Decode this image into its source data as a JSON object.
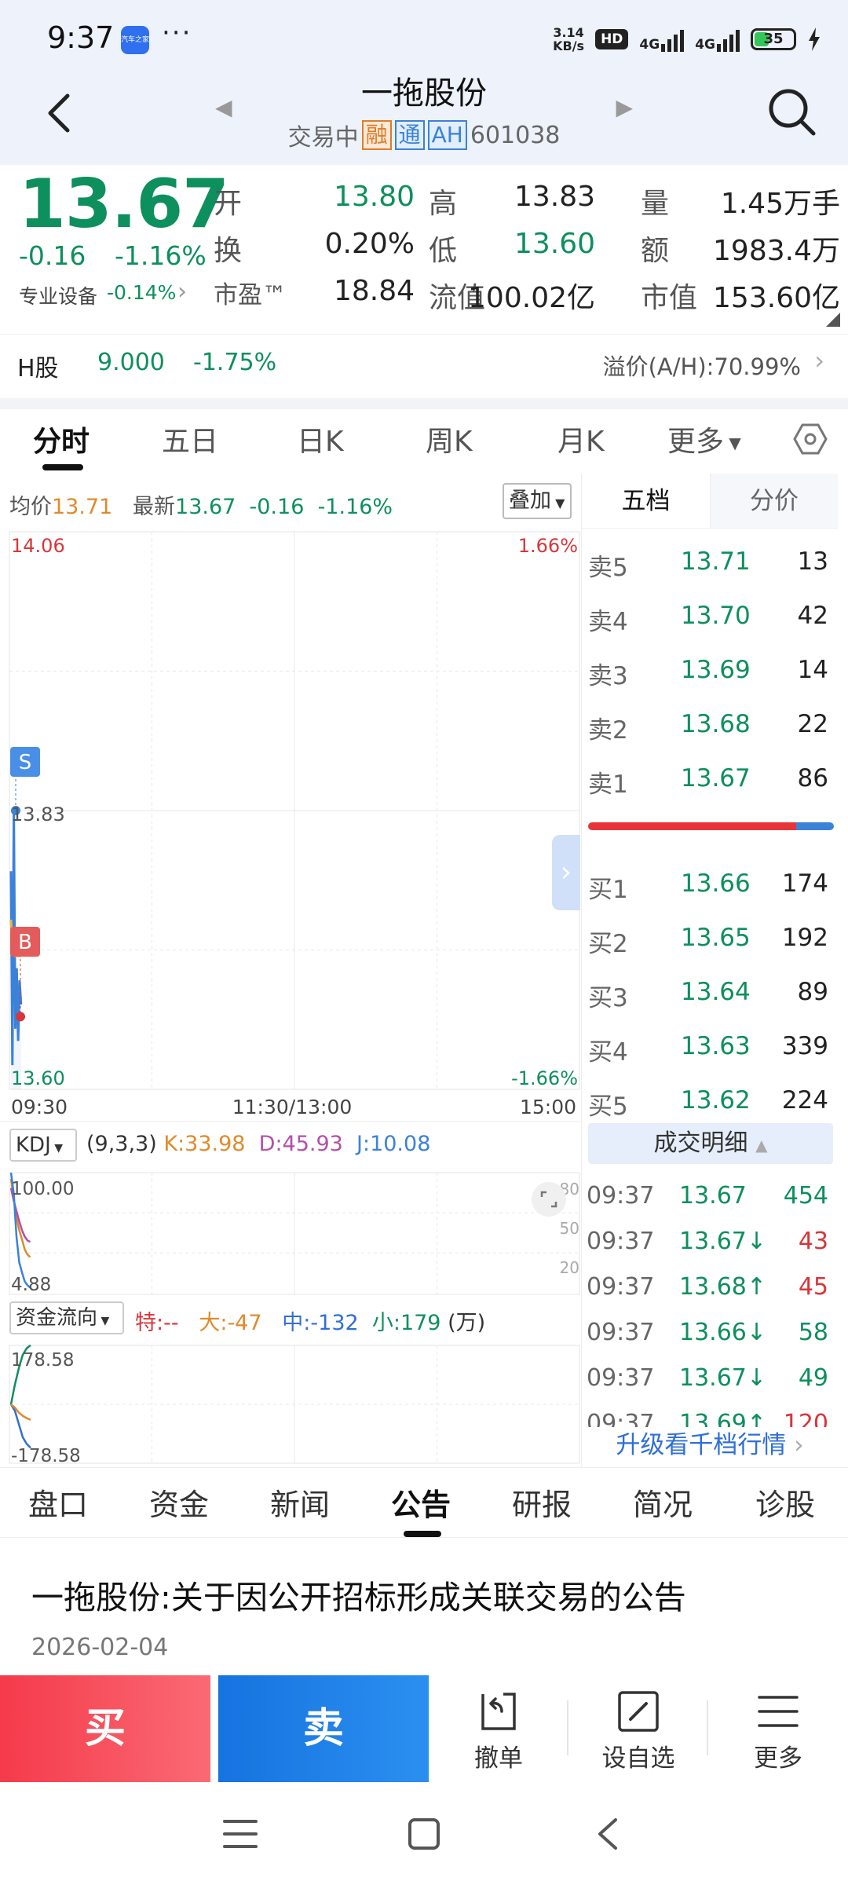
{
  "status": {
    "time": "9:37",
    "app_icon_text": "汽车之家",
    "dots": "···",
    "speed_value": "3.14",
    "speed_unit": "KB/s",
    "hd": "HD",
    "net1": "4G",
    "net2": "4G",
    "battery": "35"
  },
  "header": {
    "title": "一拖股份",
    "status": "交易中",
    "tag_rong": "融",
    "tag_tong": "通",
    "tag_ah": "AH",
    "code": "601038"
  },
  "quote": {
    "price": "13.67",
    "change": "-0.16",
    "change_pct": "-1.16%",
    "industry": "专业设备",
    "industry_chg": "-0.14%",
    "rows": [
      [
        {
          "l": "开",
          "v": "13.80",
          "c": "green"
        },
        {
          "l": "高",
          "v": "13.83",
          "c": "dark"
        },
        {
          "l": "量",
          "v": "1.45万手",
          "c": "dark"
        }
      ],
      [
        {
          "l": "换",
          "v": "0.20%",
          "c": "dark"
        },
        {
          "l": "低",
          "v": "13.60",
          "c": "green"
        },
        {
          "l": "额",
          "v": "1983.4万",
          "c": "dark"
        }
      ],
      [
        {
          "l": "市盈™",
          "v": "18.84",
          "c": "dark"
        },
        {
          "l": "流值",
          "v": "100.02亿",
          "c": "dark"
        },
        {
          "l": "市值",
          "v": "153.60亿",
          "c": "dark"
        }
      ]
    ]
  },
  "hshare": {
    "label": "H股",
    "price": "9.000",
    "change_pct": "-1.75%",
    "premium": "溢价(A/H):70.99%"
  },
  "chart_tabs": [
    "分时",
    "五日",
    "日K",
    "周K",
    "月K",
    "更多"
  ],
  "info": {
    "avg_label": "均价",
    "avg_value": "13.71",
    "latest_label": "最新",
    "latest_value": "13.67",
    "latest_chg": "-0.16",
    "latest_pct": "-1.16%",
    "overlay": "叠加"
  },
  "chart_data": [
    {
      "type": "line",
      "title": "",
      "y_top_label": "14.06",
      "y_mid_label": "13.83",
      "y_bottom_label": "13.60",
      "pct_top": "1.66%",
      "pct_bottom": "-1.66%",
      "ylim": [
        13.6,
        14.06
      ],
      "x_labels": [
        "09:30",
        "11:30/13:00",
        "15:00"
      ],
      "marker_s": "S",
      "marker_b": "B",
      "x": [
        0,
        1,
        2,
        3,
        4,
        5,
        6,
        7
      ],
      "series": [
        {
          "values": [
            13.78,
            13.62,
            13.83,
            13.65,
            13.7,
            13.64,
            13.69,
            13.67
          ]
        },
        {
          "values": [
            13.74,
            13.72,
            13.73,
            13.71,
            13.71,
            13.71,
            13.71,
            13.71
          ]
        }
      ],
      "total_points": 240
    },
    {
      "type": "line",
      "indicator": "KDJ",
      "params": "(9,3,3)",
      "k_label": "K:33.98",
      "d_label": "D:45.93",
      "j_label": "J:10.08",
      "y_top_label": "100.00",
      "y_bottom_label": "4.88",
      "right_ticks": [
        "80",
        "50",
        "20"
      ],
      "ylim": [
        4.88,
        100
      ],
      "x": [
        0,
        1,
        2,
        3,
        4,
        5,
        6,
        7
      ],
      "series": [
        {
          "values": [
            95,
            80,
            65,
            55,
            48,
            40,
            36,
            33.98
          ]
        },
        {
          "values": [
            88,
            78,
            70,
            62,
            55,
            50,
            47,
            45.93
          ]
        },
        {
          "values": [
            100,
            84,
            50,
            30,
            22,
            15,
            12,
            10.08
          ]
        }
      ]
    },
    {
      "type": "line",
      "indicator": "资金流向",
      "te": "特:--",
      "da": "大:-47",
      "zhong": "中:-132",
      "xiao": "小:179",
      "unit": "(万)",
      "y_top_label": "178.58",
      "y_bottom_label": "-178.58",
      "ylim": [
        -178.58,
        178.58
      ],
      "x": [
        0,
        1,
        2,
        3,
        4,
        5
      ],
      "series": [
        {
          "values": [
            0,
            60,
            110,
            150,
            170,
            179
          ]
        },
        {
          "values": [
            0,
            -20,
            -60,
            -100,
            -120,
            -132
          ]
        },
        {
          "values": [
            0,
            -10,
            -25,
            -35,
            -42,
            -47
          ]
        }
      ]
    }
  ],
  "orderbook": {
    "tab1": "五档",
    "tab2": "分价",
    "asks": [
      {
        "l": "卖5",
        "p": "13.71",
        "q": "13"
      },
      {
        "l": "卖4",
        "p": "13.70",
        "q": "42"
      },
      {
        "l": "卖3",
        "p": "13.69",
        "q": "14"
      },
      {
        "l": "卖2",
        "p": "13.68",
        "q": "22"
      },
      {
        "l": "卖1",
        "p": "13.67",
        "q": "86"
      }
    ],
    "bids": [
      {
        "l": "买1",
        "p": "13.66",
        "q": "174"
      },
      {
        "l": "买2",
        "p": "13.65",
        "q": "192"
      },
      {
        "l": "买3",
        "p": "13.64",
        "q": "89"
      },
      {
        "l": "买4",
        "p": "13.63",
        "q": "339"
      },
      {
        "l": "买5",
        "p": "13.62",
        "q": "224"
      }
    ],
    "detail_label": "成交明细",
    "trades": [
      {
        "t": "09:37",
        "p": "13.67",
        "pc": "green",
        "v": "454",
        "vc": "green"
      },
      {
        "t": "09:37",
        "p": "13.67↓",
        "pc": "green",
        "v": "43",
        "vc": "red"
      },
      {
        "t": "09:37",
        "p": "13.68↑",
        "pc": "green",
        "v": "45",
        "vc": "red"
      },
      {
        "t": "09:37",
        "p": "13.66↓",
        "pc": "green",
        "v": "58",
        "vc": "green"
      },
      {
        "t": "09:37",
        "p": "13.67↓",
        "pc": "green",
        "v": "49",
        "vc": "green"
      },
      {
        "t": "09:37",
        "p": "13.69↑",
        "pc": "green",
        "v": "120",
        "vc": "red"
      }
    ],
    "upgrade": "升级看千档行情"
  },
  "bottom_tabs": [
    "盘口",
    "资金",
    "新闻",
    "公告",
    "研报",
    "简况",
    "诊股"
  ],
  "announcement": {
    "title": "一拖股份:关于因公开招标形成关联交易的公告",
    "date": "2026-02-04"
  },
  "actions": {
    "buy": "买",
    "sell": "卖",
    "cancel": "撤单",
    "watch": "设自选",
    "more": "更多"
  }
}
